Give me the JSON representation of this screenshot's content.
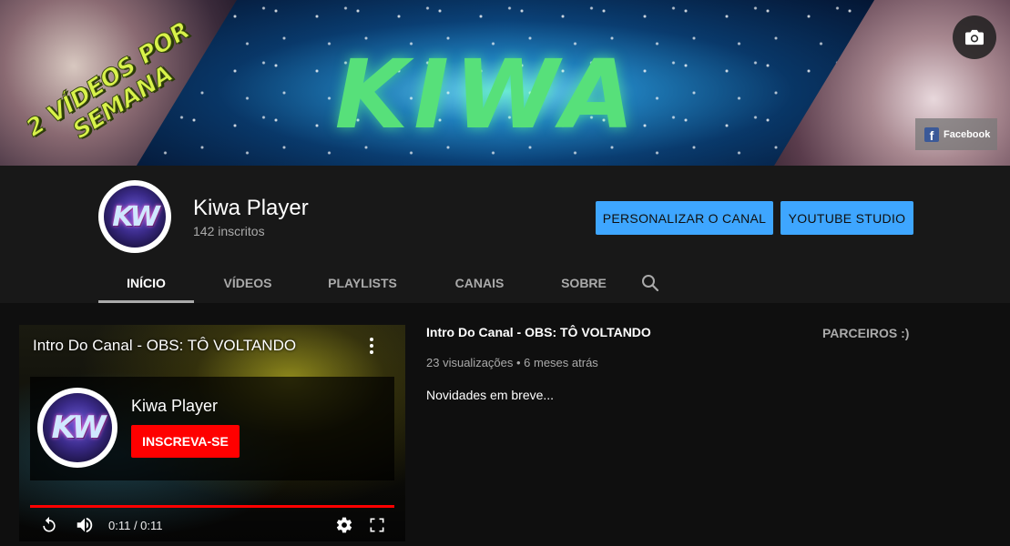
{
  "banner": {
    "logo_text": "KIWA",
    "slogan": "2 VÍDEOS POR SEMANA",
    "camera_icon": "camera-icon",
    "facebook_label": "Facebook",
    "facebook_icon": "facebook-icon"
  },
  "channel": {
    "name": "Kiwa Player",
    "subscribers": "142 inscritos",
    "avatar_initials": "KW"
  },
  "actions": {
    "customize_label": "PERSONALIZAR O CANAL",
    "studio_label": "YOUTUBE STUDIO"
  },
  "tabs": [
    {
      "label": "INÍCIO",
      "active": true
    },
    {
      "label": "VÍDEOS",
      "active": false
    },
    {
      "label": "PLAYLISTS",
      "active": false
    },
    {
      "label": "CANAIS",
      "active": false
    },
    {
      "label": "SOBRE",
      "active": false
    }
  ],
  "player": {
    "title": "Intro Do Canal - OBS: TÔ VOLTANDO",
    "endcard_channel": "Kiwa Player",
    "subscribe_label": "INSCREVA-SE",
    "time": "0:11 / 0:11",
    "progress": 1.0
  },
  "video": {
    "title": "Intro Do Canal - OBS: TÔ VOLTANDO",
    "meta": "23 visualizações • 6 meses atrás",
    "description": "Novidades em breve..."
  },
  "sidebar": {
    "featured_title": "PARCEIROS :)"
  },
  "colors": {
    "accent_blue": "#3ea6ff",
    "subscribe_red": "#ff0000",
    "background": "#181818",
    "content_background": "#0f0f0f"
  }
}
